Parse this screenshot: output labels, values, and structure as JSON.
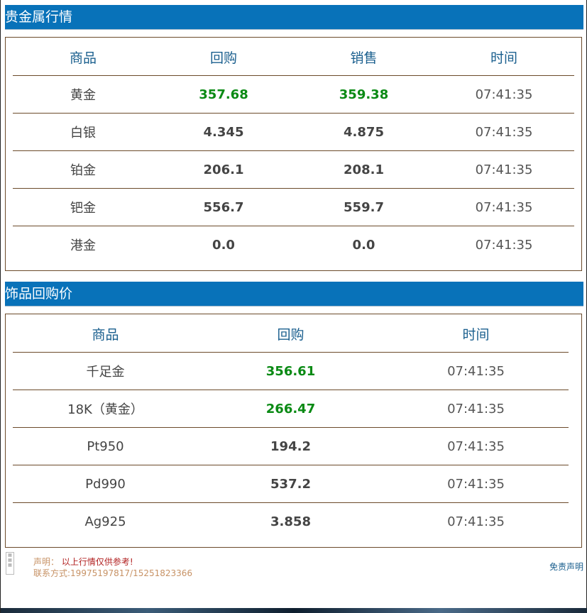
{
  "metals": {
    "title": "贵金属行情",
    "headers": [
      "商品",
      "回购",
      "销售",
      "时间"
    ],
    "rows": [
      {
        "name": "黄金",
        "buy": "357.68",
        "sell": "359.38",
        "time": "07:41:35",
        "highlight": true
      },
      {
        "name": "白银",
        "buy": "4.345",
        "sell": "4.875",
        "time": "07:41:35",
        "highlight": false
      },
      {
        "name": "铂金",
        "buy": "206.1",
        "sell": "208.1",
        "time": "07:41:35",
        "highlight": false
      },
      {
        "name": "钯金",
        "buy": "556.7",
        "sell": "559.7",
        "time": "07:41:35",
        "highlight": false
      },
      {
        "name": "港金",
        "buy": "0.0",
        "sell": "0.0",
        "time": "07:41:35",
        "highlight": false
      }
    ]
  },
  "jewelry": {
    "title": "饰品回购价",
    "headers": [
      "商品",
      "回购",
      "时间"
    ],
    "rows": [
      {
        "name": "千足金",
        "buy": "356.61",
        "time": "07:41:35",
        "highlight": true
      },
      {
        "name": "18K（黄金）",
        "buy": "266.47",
        "time": "07:41:35",
        "highlight": true
      },
      {
        "name": "Pt950",
        "buy": "194.2",
        "time": "07:41:35",
        "highlight": false
      },
      {
        "name": "Pd990",
        "buy": "537.2",
        "time": "07:41:35",
        "highlight": false
      },
      {
        "name": "Ag925",
        "buy": "3.858",
        "time": "07:41:35",
        "highlight": false
      }
    ]
  },
  "footer": {
    "statement_label": "声明：",
    "statement_text": "以上行情仅供参考!",
    "contact": "联系方式:19975197817/15251823366",
    "disclaimer_link": "免责声明"
  },
  "colors": {
    "header_bg": "#0872b9",
    "up_value": "#0a8a14",
    "border": "#6b4a2a"
  }
}
